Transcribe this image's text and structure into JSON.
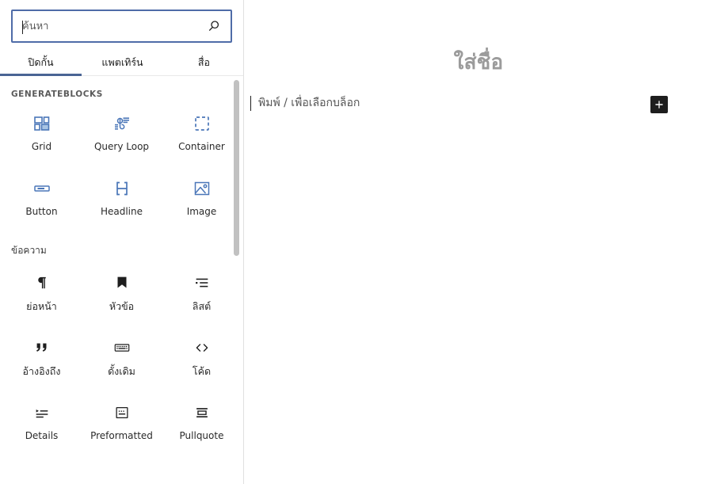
{
  "inserter": {
    "search": {
      "placeholder": "ค้นหา",
      "value": "",
      "icon": "search-icon",
      "border_color": "#4f6ca8"
    },
    "tabs": [
      {
        "label": "ปิดกั้น",
        "active": true
      },
      {
        "label": "แพตเทิร์น",
        "active": false
      },
      {
        "label": "สื่อ",
        "active": false
      }
    ],
    "tab_underline_color": "#4a6494",
    "categories": [
      {
        "title": "GENERATEBLOCKS",
        "thai": false,
        "icon_color": "#4a76b8",
        "blocks": [
          {
            "label": "Grid",
            "icon": "grid-icon",
            "thai": false
          },
          {
            "label": "Query Loop",
            "icon": "query-loop-icon",
            "thai": false
          },
          {
            "label": "Container",
            "icon": "container-icon",
            "thai": false
          },
          {
            "label": "Button",
            "icon": "button-icon",
            "thai": false
          },
          {
            "label": "Headline",
            "icon": "headline-icon",
            "thai": false
          },
          {
            "label": "Image",
            "icon": "image-icon",
            "thai": false
          }
        ]
      },
      {
        "title": "ข้อความ",
        "thai": true,
        "icon_color": "#1e1e1e",
        "blocks": [
          {
            "label": "ย่อหน้า",
            "icon": "paragraph-icon",
            "thai": true
          },
          {
            "label": "หัวข้อ",
            "icon": "heading-icon",
            "thai": true
          },
          {
            "label": "ลิสต์",
            "icon": "list-icon",
            "thai": true
          },
          {
            "label": "อ้างอิงถึง",
            "icon": "quote-icon",
            "thai": true
          },
          {
            "label": "ดั้งเดิม",
            "icon": "classic-icon",
            "thai": true
          },
          {
            "label": "โค้ด",
            "icon": "code-icon",
            "thai": true
          },
          {
            "label": "Details",
            "icon": "details-icon",
            "thai": false
          },
          {
            "label": "Preformatted",
            "icon": "preformatted-icon",
            "thai": false
          },
          {
            "label": "Pullquote",
            "icon": "pullquote-icon",
            "thai": false
          }
        ]
      }
    ],
    "scrollbar": {
      "name": "inserter-scrollbar"
    }
  },
  "editor": {
    "title_placeholder": "ใส่ชื่อ",
    "body_placeholder": "พิมพ์ / เพื่อเลือกบล็อก",
    "add_block_label": "+",
    "add_block_color": "#1e1e1e"
  }
}
